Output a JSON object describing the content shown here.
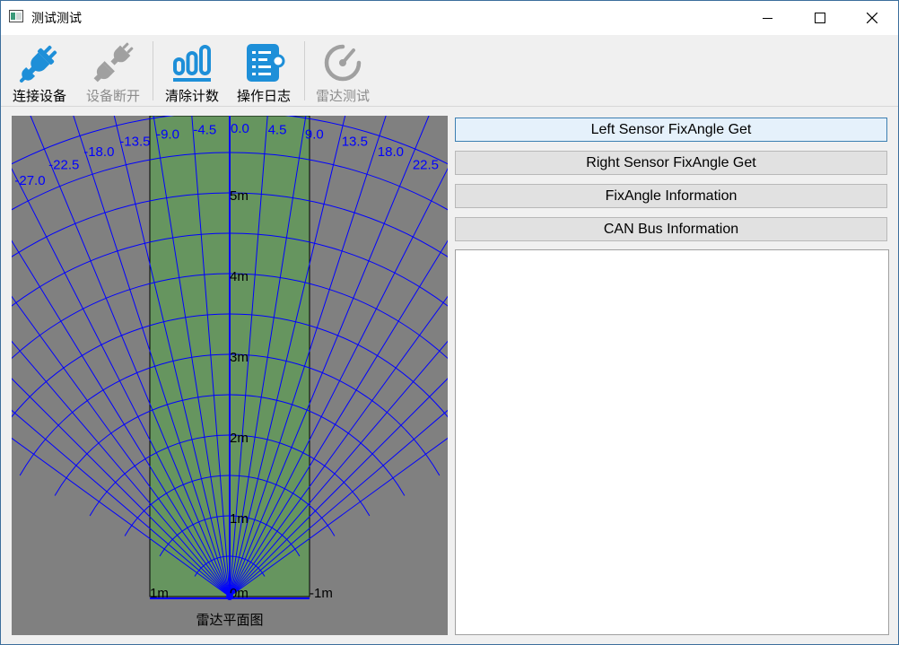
{
  "window": {
    "title": "测试测试"
  },
  "toolbar": {
    "items": [
      {
        "label": "连接设备",
        "icon": "connect-plug-icon",
        "enabled": true
      },
      {
        "label": "设备断开",
        "icon": "disconnect-plug-icon",
        "enabled": false
      },
      {
        "label": "清除计数",
        "icon": "clear-count-icon",
        "enabled": true
      },
      {
        "label": "操作日志",
        "icon": "operation-log-icon",
        "enabled": true
      },
      {
        "label": "雷达测试",
        "icon": "radar-gauge-icon",
        "enabled": false
      }
    ]
  },
  "radar": {
    "caption": "雷达平面图",
    "range_labels": [
      "1m",
      "2m",
      "3m",
      "4m",
      "5m"
    ],
    "angle_labels": [
      "-27.0",
      "-22.5",
      "-18.0",
      "-13.5",
      "-9.0",
      "-4.5",
      "0.0",
      "4.5",
      "9.0",
      "13.5",
      "18.0",
      "22.5"
    ],
    "bottom_labels": {
      "left": "1m",
      "center": "0m",
      "right": "-1m"
    },
    "colors": {
      "background": "#808080",
      "zone": "#66955f",
      "grid": "#0000ff"
    }
  },
  "buttons": {
    "left_sensor": "Left Sensor FixAngle Get",
    "right_sensor": "Right Sensor FixAngle Get",
    "fixangle_info": "FixAngle Information",
    "can_bus_info": "CAN Bus Information"
  },
  "log": {
    "text": ""
  }
}
